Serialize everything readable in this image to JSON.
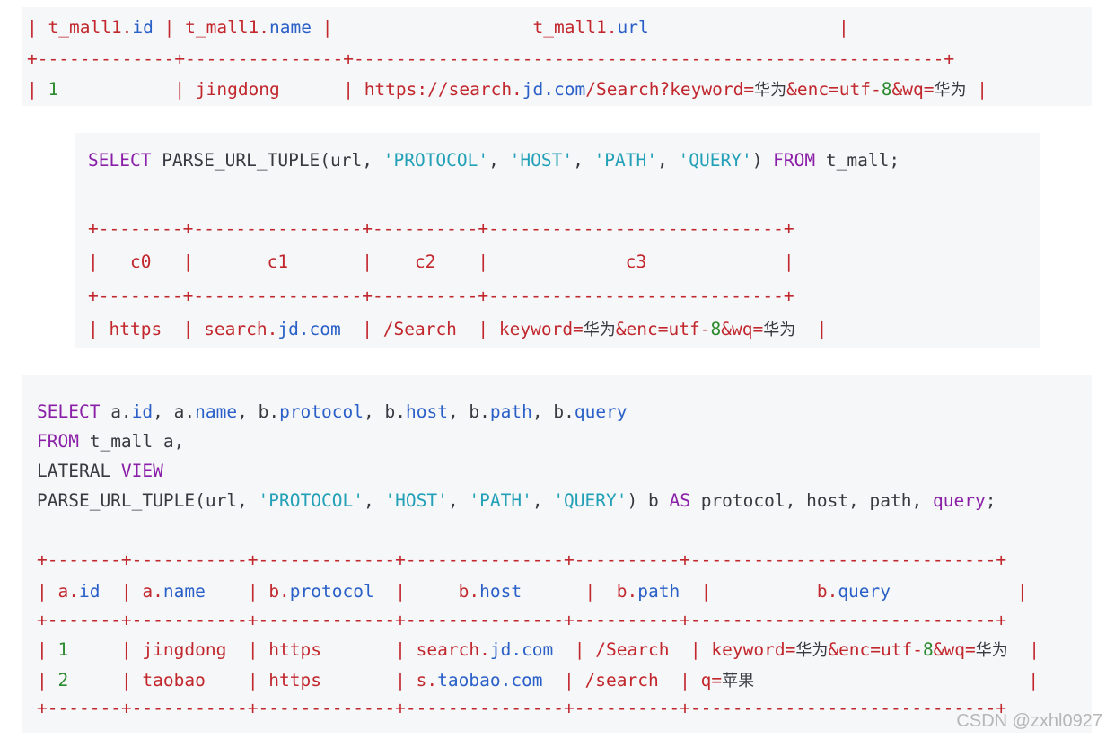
{
  "blocks": [
    {
      "lines": [
        [
          [
            "| t_mall1.",
            "op"
          ],
          [
            "id",
            "dot"
          ],
          [
            " | t_mall1.",
            "op"
          ],
          [
            "name",
            "dot"
          ],
          [
            " |                   t_mall1.",
            "op"
          ],
          [
            "url",
            "dot"
          ],
          [
            "                  |",
            "op"
          ]
        ],
        [
          [
            "+-------------+---------------+--------------------------------------------------------+",
            "op"
          ]
        ],
        [
          [
            "| ",
            "op"
          ],
          [
            "1",
            "num"
          ],
          [
            "           | jingdong      | https://search.",
            "op"
          ],
          [
            "jd.com",
            "dot"
          ],
          [
            "/Search?keyword=",
            "op"
          ],
          [
            "华为",
            "cn"
          ],
          [
            "&enc=utf-",
            "op"
          ],
          [
            "8",
            "num"
          ],
          [
            "&wq=",
            "op"
          ],
          [
            "华为",
            "cn"
          ],
          [
            " |",
            "op"
          ]
        ]
      ]
    },
    {
      "lines": [
        [
          [
            "SELECT",
            "kw"
          ],
          [
            " PARSE_URL_TUPLE(url, ",
            "plain"
          ],
          [
            "'PROTOCOL'",
            "str"
          ],
          [
            ", ",
            "plain"
          ],
          [
            "'HOST'",
            "str"
          ],
          [
            ", ",
            "plain"
          ],
          [
            "'PATH'",
            "str"
          ],
          [
            ", ",
            "plain"
          ],
          [
            "'QUERY'",
            "str"
          ],
          [
            ") ",
            "plain"
          ],
          [
            "FROM",
            "kw"
          ],
          [
            " t_mall;",
            "plain"
          ]
        ],
        [
          [
            "",
            "plain"
          ]
        ],
        [
          [
            "+--------+----------------+----------+----------------------------+",
            "op"
          ]
        ],
        [
          [
            "|   c0   |       c1       |    c2    |             c3             |",
            "op"
          ]
        ],
        [
          [
            "+--------+----------------+----------+----------------------------+",
            "op"
          ]
        ],
        [
          [
            "| https  | search.",
            "op"
          ],
          [
            "jd.com",
            "dot"
          ],
          [
            "  | /Search  | keyword=",
            "op"
          ],
          [
            "华为",
            "cn"
          ],
          [
            "&enc=utf-",
            "op"
          ],
          [
            "8",
            "num"
          ],
          [
            "&wq=",
            "op"
          ],
          [
            "华为",
            "cn"
          ],
          [
            "  |",
            "op"
          ]
        ]
      ]
    },
    {
      "lines": [
        [
          [
            "SELECT",
            "kw"
          ],
          [
            " a.",
            "plain"
          ],
          [
            "id",
            "dot"
          ],
          [
            ", a.",
            "plain"
          ],
          [
            "name",
            "dot"
          ],
          [
            ", b.",
            "plain"
          ],
          [
            "protocol",
            "dot"
          ],
          [
            ", b.",
            "plain"
          ],
          [
            "host",
            "dot"
          ],
          [
            ", b.",
            "plain"
          ],
          [
            "path",
            "dot"
          ],
          [
            ", b.",
            "plain"
          ],
          [
            "query",
            "dot"
          ]
        ],
        [
          [
            "FROM",
            "kw"
          ],
          [
            " t_mall a,",
            "plain"
          ]
        ],
        [
          [
            "LATERAL ",
            "plain"
          ],
          [
            "VIEW",
            "kw"
          ]
        ],
        [
          [
            "PARSE_URL_TUPLE(url, ",
            "plain"
          ],
          [
            "'PROTOCOL'",
            "str"
          ],
          [
            ", ",
            "plain"
          ],
          [
            "'HOST'",
            "str"
          ],
          [
            ", ",
            "plain"
          ],
          [
            "'PATH'",
            "str"
          ],
          [
            ", ",
            "plain"
          ],
          [
            "'QUERY'",
            "str"
          ],
          [
            ") b ",
            "plain"
          ],
          [
            "AS",
            "kw"
          ],
          [
            " protocol, host, path, ",
            "plain"
          ],
          [
            "query",
            "kw"
          ],
          [
            ";",
            "plain"
          ]
        ],
        [
          [
            "",
            "plain"
          ]
        ],
        [
          [
            "+-------+-----------+-------------+---------------+----------+-----------------------------+",
            "op"
          ]
        ],
        [
          [
            "| a.",
            "op"
          ],
          [
            "id",
            "dot"
          ],
          [
            "  | a.",
            "op"
          ],
          [
            "name",
            "dot"
          ],
          [
            "    | b.",
            "op"
          ],
          [
            "protocol",
            "dot"
          ],
          [
            "  |     b.",
            "op"
          ],
          [
            "host",
            "dot"
          ],
          [
            "      |  b.",
            "op"
          ],
          [
            "path",
            "dot"
          ],
          [
            "  |          b.",
            "op"
          ],
          [
            "query",
            "dot"
          ],
          [
            "            |",
            "op"
          ]
        ],
        [
          [
            "+-------+-----------+-------------+---------------+----------+-----------------------------+",
            "op"
          ]
        ],
        [
          [
            "| ",
            "op"
          ],
          [
            "1",
            "num"
          ],
          [
            "     | jingdong  | https       | search.",
            "op"
          ],
          [
            "jd.com",
            "dot"
          ],
          [
            "  | /Search  | keyword=",
            "op"
          ],
          [
            "华为",
            "cn"
          ],
          [
            "&enc=utf-",
            "op"
          ],
          [
            "8",
            "num"
          ],
          [
            "&wq=",
            "op"
          ],
          [
            "华为",
            "cn"
          ],
          [
            "  |",
            "op"
          ]
        ],
        [
          [
            "| ",
            "op"
          ],
          [
            "2",
            "num"
          ],
          [
            "     | taobao    | https       | s.",
            "op"
          ],
          [
            "taobao.com",
            "dot"
          ],
          [
            "  | /search  | q=",
            "op"
          ],
          [
            "苹果",
            "cn"
          ],
          [
            "                          |",
            "op"
          ]
        ],
        [
          [
            "+-------+-----------+-------------+---------------+----------+-----------------------------+",
            "op"
          ]
        ]
      ]
    }
  ],
  "watermark": "CSDN @zxhl0927"
}
